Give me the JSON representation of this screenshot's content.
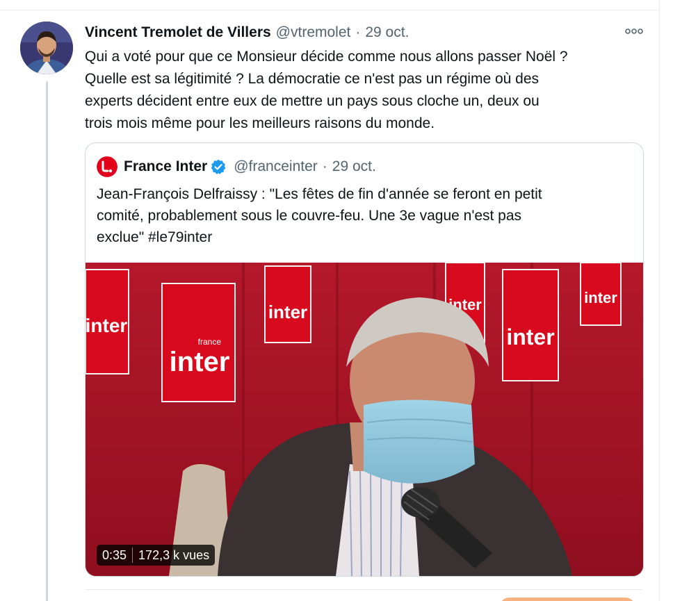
{
  "tweet": {
    "author_name": "Vincent Tremolet de Villers",
    "author_handle": "@vtremolet",
    "separator": "·",
    "date": "29 oct.",
    "text": "Qui a voté pour que ce Monsieur décide comme nous allons passer Noël ?\nQuelle est sa légitimité ? La démocratie ce n'est pas un régime où des\nexperts décident entre eux de mettre un pays sous cloche un, deux ou\ntrois mois même pour les meilleurs raisons du monde.",
    "more_icon": "more-dots-icon",
    "avatar_icon": "user-avatar"
  },
  "quote": {
    "author_name": "France Inter",
    "verified_icon": "verified-badge-icon",
    "author_handle": "@franceinter",
    "separator": "·",
    "date": "29 oct.",
    "text": "Jean-François Delfraissy : \"Les fêtes de fin d'année se feront en petit\ncomité, probablement sous le couvre-feu. Une 3e vague n'est pas\nexclue\" #le79inter",
    "avatar_icon": "france-inter-logo"
  },
  "video": {
    "duration": "0:35",
    "views": "172,3 k vues",
    "background_logo_small": "france",
    "background_logo_text": "inter"
  },
  "colors": {
    "text_primary": "#0f1419",
    "text_secondary": "#536471",
    "border": "#cfd9de",
    "verified_blue": "#1d9bf0",
    "brand_red": "#e2001a",
    "video_red": "#a11424"
  }
}
